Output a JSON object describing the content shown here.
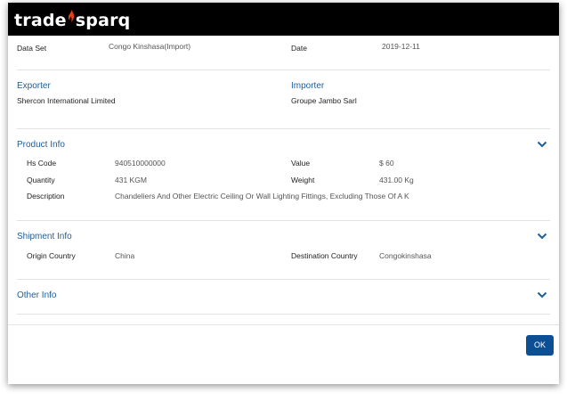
{
  "brand": {
    "logo_left": "trade",
    "logo_right": "sparq"
  },
  "summary": {
    "data_set_label": "Data Set",
    "data_set_value": "Congo Kinshasa(Import)",
    "date_label": "Date",
    "date_value": "2019-12-11"
  },
  "parties": {
    "exporter_label": "Exporter",
    "exporter_value": "Shercon International Limited",
    "importer_label": "Importer",
    "importer_value": "Groupe Jambo Sarl"
  },
  "product_info": {
    "title": "Product Info",
    "hs_code_label": "Hs Code",
    "hs_code_value": "940510000000",
    "value_label": "Value",
    "value_value": "$ 60",
    "quantity_label": "Quantity",
    "quantity_value": "431 KGM",
    "weight_label": "Weight",
    "weight_value": "431.00 Kg",
    "description_label": "Description",
    "description_value": "Chandeliers And Other Electric Ceiling Or Wall Lighting Fittings, Excluding Those Of A K"
  },
  "shipment_info": {
    "title": "Shipment Info",
    "origin_label": "Origin Country",
    "origin_value": "China",
    "destination_label": "Destination Country",
    "destination_value": "Congokinshasa"
  },
  "other_info": {
    "title": "Other Info"
  },
  "footer": {
    "ok_label": "OK"
  },
  "colors": {
    "accent": "#1f5d99",
    "button": "#0d4f94",
    "header": "#000000",
    "flame": "#e0401e"
  },
  "icons": {
    "section_toggle": "chevron-down-icon"
  }
}
